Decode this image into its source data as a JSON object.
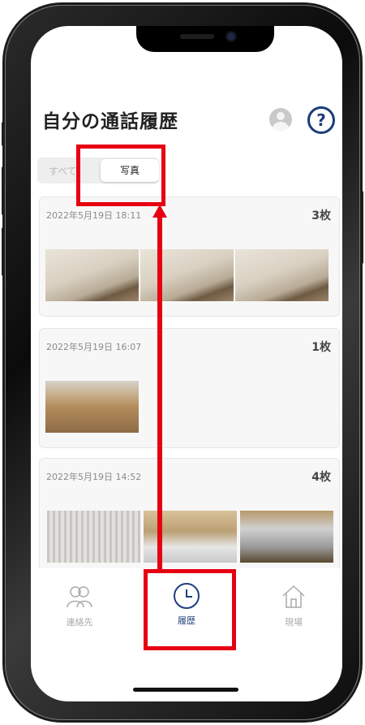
{
  "header": {
    "title": "自分の通話履歴",
    "help_label": "?"
  },
  "segment": {
    "all_label": "すべて",
    "photo_label": "写真"
  },
  "cards": [
    {
      "date": "2022年5月19日 18:11",
      "count": "3枚"
    },
    {
      "date": "2022年5月19日 16:07",
      "count": "1枚"
    },
    {
      "date": "2022年5月19日 14:52",
      "count": "4枚"
    }
  ],
  "tabbar": {
    "contacts_label": "連絡先",
    "history_label": "履歴",
    "site_label": "現場"
  },
  "colors": {
    "accent": "#1f3f7a",
    "annotation": "#e60012"
  }
}
